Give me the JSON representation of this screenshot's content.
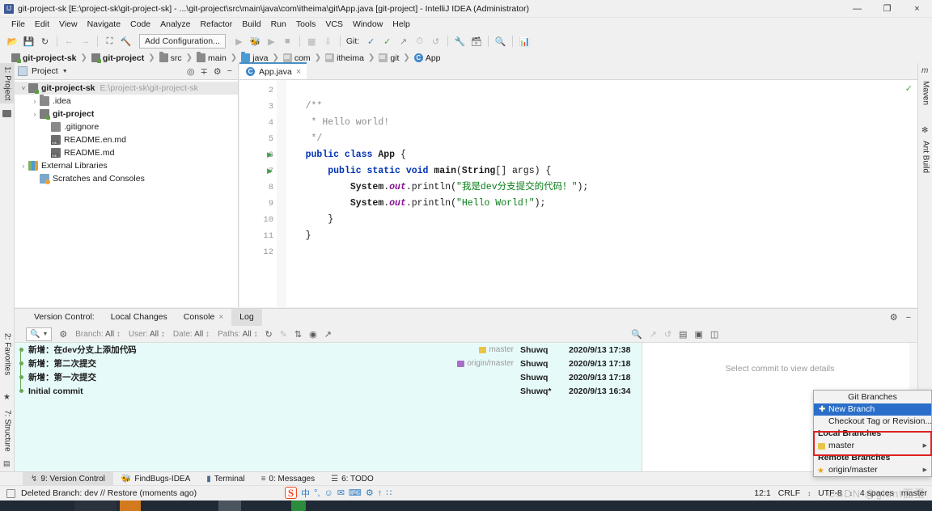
{
  "window": {
    "title": "git-project-sk [E:\\project-sk\\git-project-sk] - ...\\git-project\\src\\main\\java\\com\\itheima\\git\\App.java [git-project] - IntelliJ IDEA (Administrator)",
    "minimize": "—",
    "maximize": "❐",
    "close": "×"
  },
  "menu": [
    "File",
    "Edit",
    "View",
    "Navigate",
    "Code",
    "Analyze",
    "Refactor",
    "Build",
    "Run",
    "Tools",
    "VCS",
    "Window",
    "Help"
  ],
  "toolbar": {
    "add_configuration": "Add Configuration...",
    "git_label": "Git:"
  },
  "breadcrumb": [
    {
      "label": "git-project-sk",
      "icon": "module-icon",
      "bold": true
    },
    {
      "label": "git-project",
      "icon": "module-icon",
      "bold": true
    },
    {
      "label": "src",
      "icon": "folder-icon",
      "bold": false
    },
    {
      "label": "main",
      "icon": "folder-icon",
      "bold": false
    },
    {
      "label": "java",
      "icon": "source-folder-icon",
      "bold": false
    },
    {
      "label": "com",
      "icon": "package-icon",
      "bold": false
    },
    {
      "label": "itheima",
      "icon": "package-icon",
      "bold": false
    },
    {
      "label": "git",
      "icon": "package-icon",
      "bold": false
    },
    {
      "label": "App",
      "icon": "java-class-icon",
      "bold": false
    }
  ],
  "left_strip": [
    {
      "label": "1: Project",
      "active": true
    },
    {
      "label": "2: Favorites",
      "active": false
    },
    {
      "label": "7: Structure",
      "active": false
    }
  ],
  "right_strip": [
    {
      "label": "Maven"
    },
    {
      "label": "Ant Build"
    }
  ],
  "project_panel": {
    "title": "Project",
    "tree": [
      {
        "label": "git-project-sk",
        "path": "E:\\project-sk\\git-project-sk",
        "indent": 0,
        "arrow": "˅",
        "icon": "module-icon",
        "bold": true,
        "selected": true
      },
      {
        "label": ".idea",
        "path": "",
        "indent": 1,
        "arrow": "›",
        "icon": "folder-icon",
        "bold": false,
        "selected": false
      },
      {
        "label": "git-project",
        "path": "",
        "indent": 1,
        "arrow": "›",
        "icon": "module-icon",
        "bold": true,
        "selected": false
      },
      {
        "label": ".gitignore",
        "path": "",
        "indent": 2,
        "arrow": "",
        "icon": "gitignore-icon",
        "bold": false,
        "selected": false
      },
      {
        "label": "README.en.md",
        "path": "",
        "indent": 2,
        "arrow": "",
        "icon": "markdown-icon",
        "bold": false,
        "selected": false
      },
      {
        "label": "README.md",
        "path": "",
        "indent": 2,
        "arrow": "",
        "icon": "markdown-icon",
        "bold": false,
        "selected": false
      },
      {
        "label": "External Libraries",
        "path": "",
        "indent": 0,
        "arrow": "›",
        "icon": "library-icon",
        "bold": false,
        "selected": false
      },
      {
        "label": "Scratches and Consoles",
        "path": "",
        "indent": 1,
        "arrow": "",
        "icon": "scratches-icon",
        "bold": false,
        "selected": false
      }
    ]
  },
  "editor": {
    "tab": "App.java",
    "lines": [
      {
        "num": "2",
        "run": false,
        "html": ""
      },
      {
        "num": "3",
        "run": false,
        "html": "    <span class='cmt'>/**</span>"
      },
      {
        "num": "4",
        "run": false,
        "html": "     <span class='cmt'>* Hello world!</span>"
      },
      {
        "num": "5",
        "run": false,
        "html": "     <span class='cmt'>*/</span>"
      },
      {
        "num": "6",
        "run": true,
        "html": "    <span class='kw'>public class</span> <span class='cls-nm'>App</span> {"
      },
      {
        "num": "7",
        "run": true,
        "html": "        <span class='kw'>public static void</span> <span class='cls-nm'>main</span>(<span class='cls-nm'>String</span>[] args) {"
      },
      {
        "num": "8",
        "run": false,
        "html": "            <span class='sys'>System</span>.<span class='fld'>out</span>.println(<span class='str'>\"我是dev分支提交的代码！\"</span>);"
      },
      {
        "num": "9",
        "run": false,
        "html": "            <span class='sys'>System</span>.<span class='fld'>out</span>.println(<span class='str'>\"Hello World!\"</span>);"
      },
      {
        "num": "10",
        "run": false,
        "html": "        }"
      },
      {
        "num": "11",
        "run": false,
        "html": "    }"
      },
      {
        "num": "12",
        "run": false,
        "html": ""
      }
    ]
  },
  "vcs": {
    "tabs": [
      {
        "label": "Version Control:",
        "active": false,
        "closable": false
      },
      {
        "label": "Local Changes",
        "active": false,
        "closable": false
      },
      {
        "label": "Console",
        "active": false,
        "closable": true
      },
      {
        "label": "Log",
        "active": true,
        "closable": false
      }
    ],
    "search_placeholder": "",
    "filters": [
      {
        "name": "Branch:",
        "value": "All"
      },
      {
        "name": "User:",
        "value": "All"
      },
      {
        "name": "Date:",
        "value": "All"
      },
      {
        "name": "Paths:",
        "value": "All"
      }
    ],
    "commits": [
      {
        "message": "新增：在dev分支上添加代码",
        "tag": "master",
        "tag_type": "local",
        "author": "Shuwq",
        "date": "2020/9/13 17:38"
      },
      {
        "message": "新增：第二次提交",
        "tag": "origin/master",
        "tag_type": "remote",
        "author": "Shuwq",
        "date": "2020/9/13 17:18"
      },
      {
        "message": "新增：第一次提交",
        "tag": "",
        "tag_type": "",
        "author": "Shuwq",
        "date": "2020/9/13 17:18"
      },
      {
        "message": "Initial commit",
        "tag": "",
        "tag_type": "",
        "author": "Shuwq*",
        "date": "2020/9/13 16:34"
      }
    ],
    "detail_placeholder": "Select commit to view details"
  },
  "git_branches_popup": {
    "title": "Git Branches",
    "new_branch": "New Branch",
    "checkout": "Checkout Tag or Revision...",
    "local_heading": "Local Branches",
    "local_branches": [
      "master"
    ],
    "remote_heading": "Remote Branches",
    "remote_branches": [
      "origin/master"
    ],
    "highlight_color": "#e02020"
  },
  "bottom_tabs": [
    {
      "label": "9: Version Control",
      "active": true,
      "icon": "branch-icon"
    },
    {
      "label": "FindBugs-IDEA",
      "active": false,
      "icon": "bug-icon"
    },
    {
      "label": "Terminal",
      "active": false,
      "icon": "terminal-icon"
    },
    {
      "label": "0: Messages",
      "active": false,
      "icon": "messages-icon"
    },
    {
      "label": "6: TODO",
      "active": false,
      "icon": "todo-icon"
    }
  ],
  "statusbar": {
    "message": "Deleted Branch: dev // Restore (moments ago)",
    "caret": "12:1",
    "line_separator": "CRLF",
    "encoding": "UTF-8",
    "indent": "4 spaces",
    "branch": "master"
  },
  "ime": {
    "logo": "S",
    "items": [
      "中",
      "°,",
      "☺",
      "✉",
      "⌨",
      "⚙",
      "↑",
      "∷"
    ]
  },
  "watermark": "CSDN @giant面蛋"
}
